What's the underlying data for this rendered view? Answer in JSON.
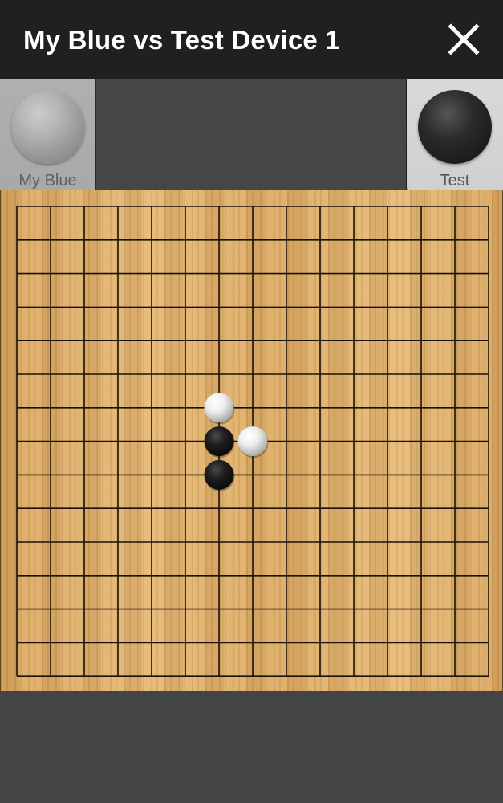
{
  "header": {
    "title": "My Blue vs Test Device 1",
    "close_icon": "close-icon"
  },
  "players": {
    "left": {
      "name": "My Blue",
      "stone_color": "white",
      "active": false
    },
    "right": {
      "name": "Test",
      "stone_color": "black",
      "active": true
    }
  },
  "board": {
    "lines": 15,
    "colors": {
      "wood": "#e0b270",
      "line": "#1a1208",
      "black_stone": "#1b1b1b",
      "white_stone": "#f2f2f2"
    },
    "stones": [
      {
        "color": "white",
        "col": 6,
        "row": 6
      },
      {
        "color": "black",
        "col": 6,
        "row": 7
      },
      {
        "color": "white",
        "col": 7,
        "row": 7
      },
      {
        "color": "black",
        "col": 6,
        "row": 8
      }
    ]
  }
}
